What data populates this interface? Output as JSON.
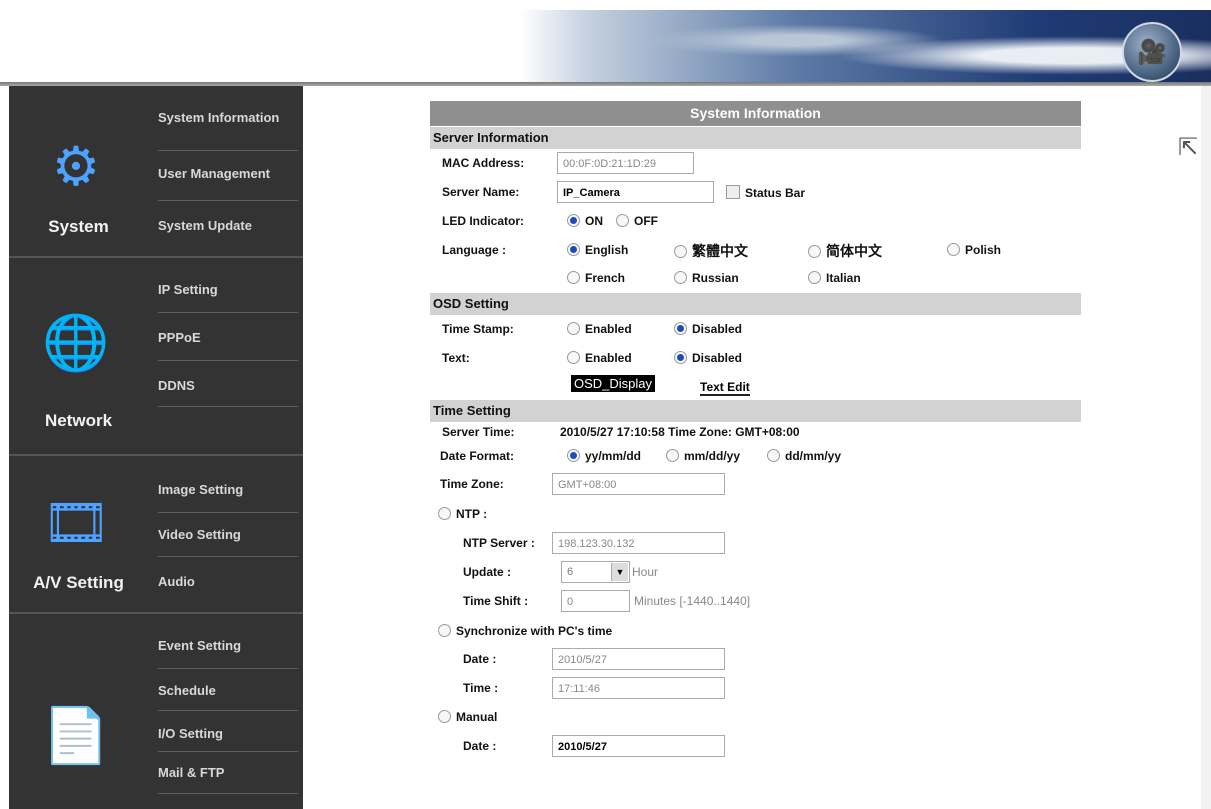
{
  "sidebar": {
    "groups": [
      {
        "title": "System",
        "icon": "gears-icon",
        "items": [
          "System Information",
          "User Management",
          "System Update"
        ]
      },
      {
        "title": "Network",
        "icon": "globe-icon",
        "items": [
          "IP Setting",
          "PPPoE",
          "DDNS"
        ]
      },
      {
        "title": "A/V Setting",
        "icon": "av-media-icon",
        "items": [
          "Image Setting",
          "Video Setting",
          "Audio"
        ]
      },
      {
        "title": "",
        "icon": "document-icon",
        "items": [
          "Event Setting",
          "Schedule",
          "I/O Setting",
          "Mail & FTP"
        ]
      }
    ]
  },
  "main": {
    "title": "System Information",
    "server_info": {
      "header": "Server Information",
      "mac_label": "MAC Address:",
      "mac_value": "00:0F:0D:21:1D:29",
      "server_name_label": "Server Name:",
      "server_name_value": "IP_Camera",
      "status_bar_label": "Status Bar",
      "led_label": "LED Indicator:",
      "led_on": "ON",
      "led_off": "OFF",
      "language_label": "Language :",
      "languages": [
        "English",
        "繁體中文",
        "简体中文",
        "Polish",
        "French",
        "Russian",
        "Italian"
      ],
      "language_selected": "English"
    },
    "osd": {
      "header": "OSD Setting",
      "timestamp_label": "Time Stamp:",
      "text_label": "Text:",
      "enabled": "Enabled",
      "disabled": "Disabled",
      "display_text": "OSD_Display",
      "text_edit": "Text Edit"
    },
    "time": {
      "header": "Time Setting",
      "server_time_label": "Server Time:",
      "server_time_value": "2010/5/27 17:10:58 Time Zone: GMT+08:00",
      "date_format_label": "Date Format:",
      "formats": [
        "yy/mm/dd",
        "mm/dd/yy",
        "dd/mm/yy"
      ],
      "time_zone_label": "Time Zone:",
      "time_zone_value": "GMT+08:00",
      "ntp_label": "NTP :",
      "ntp_server_label": "NTP Server :",
      "ntp_server_value": "198.123.30.132",
      "update_label": "Update :",
      "update_value": "6",
      "update_unit": "Hour",
      "time_shift_label": "Time Shift :",
      "time_shift_value": "0",
      "time_shift_unit": "Minutes  [-1440..1440]",
      "sync_label": "Synchronize with PC's time",
      "date_label": "Date :",
      "sync_date_value": "2010/5/27",
      "time_label": "Time :",
      "sync_time_value": "17:11:46",
      "manual_label": "Manual",
      "manual_date_value": "2010/5/27"
    }
  }
}
